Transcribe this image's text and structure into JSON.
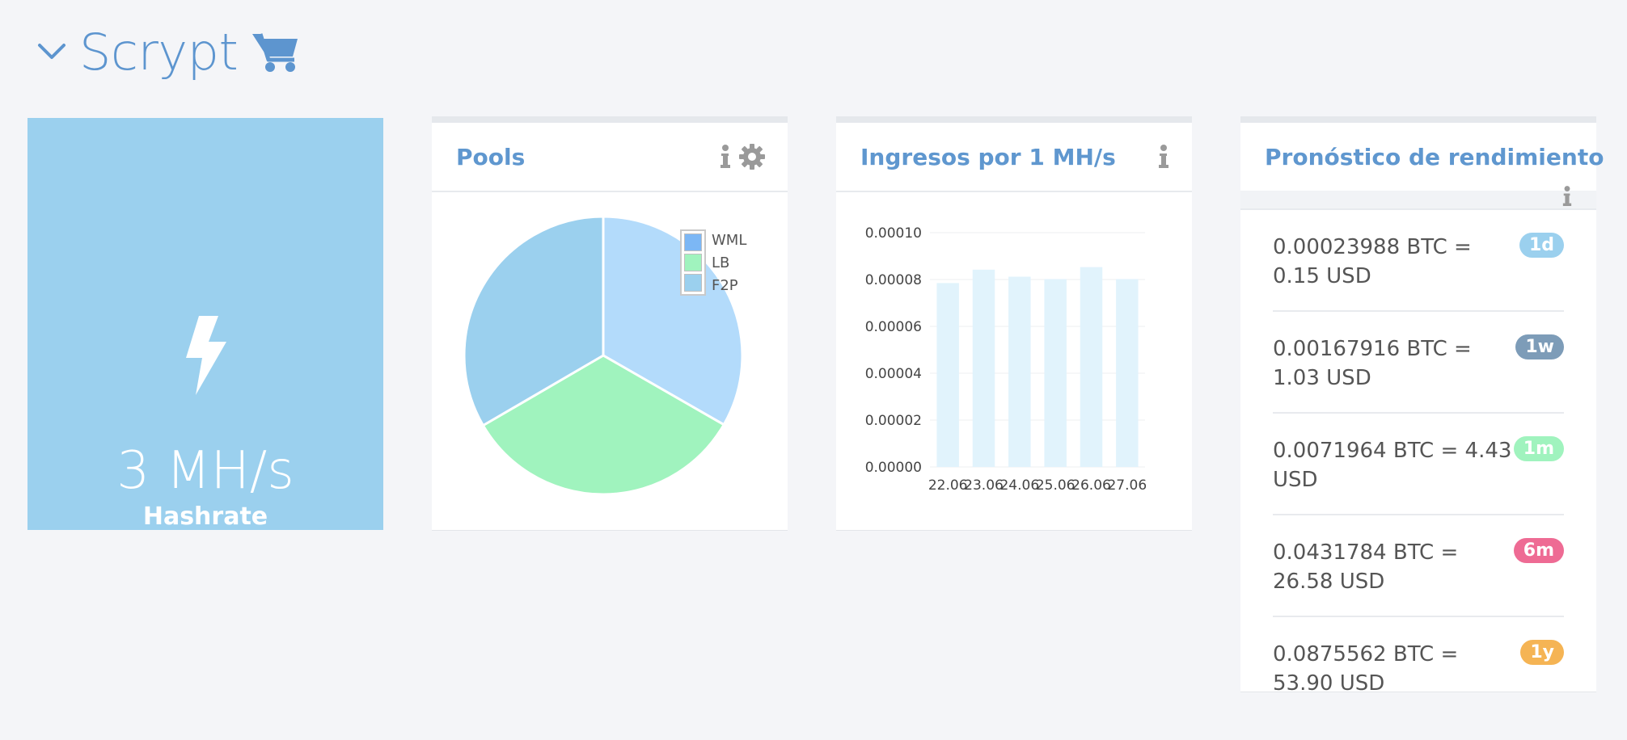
{
  "header": {
    "title": "Scrypt"
  },
  "icons": {
    "chevron": "chevron-down-icon",
    "cart": "shopping-cart-icon",
    "bolt": "lightning-bolt-icon",
    "info": "info-icon",
    "gear": "gear-icon"
  },
  "colors": {
    "accent": "#5d95cf",
    "hashrate_tile": "#9bd0ee",
    "title_text": "#5f97cf"
  },
  "hashrate": {
    "value": "3 MH/s",
    "label": "Hashrate"
  },
  "pools": {
    "title": "Pools",
    "chart_data": {
      "type": "pie",
      "labels": [
        "WML",
        "LB",
        "F2P"
      ],
      "values": [
        33.3,
        33.3,
        33.4
      ],
      "colors": [
        "#b3dbfb",
        "#a0f3be",
        "#9bd0ee"
      ],
      "legend_colors": [
        "#7cb7f5",
        "#a0f3be",
        "#9bd0ee"
      ],
      "legend_position": "top-right"
    }
  },
  "income": {
    "title": "Ingresos por 1 MH/s",
    "chart_data": {
      "type": "bar",
      "categories": [
        "22.06",
        "23.06",
        "24.06",
        "25.06",
        "26.06",
        "27.06"
      ],
      "values": [
        7.85e-05,
        8.42e-05,
        8.12e-05,
        8.02e-05,
        8.53e-05,
        8.02e-05
      ],
      "y_ticks": [
        "0.00000",
        "0.00002",
        "0.00004",
        "0.00006",
        "0.00008",
        "0.00010"
      ],
      "ylim": [
        0,
        0.0001
      ],
      "grid": true,
      "bar_color": "#e1f3fc"
    }
  },
  "forecast": {
    "title": "Pronóstico de rendimiento",
    "rows": [
      {
        "text": "0.00023988 BTC = 0.15 USD",
        "badge": "1d",
        "color": "#9bd0ee"
      },
      {
        "text": "0.00167916 BTC = 1.03 USD",
        "badge": "1w",
        "color": "#7d9cb8"
      },
      {
        "text": "0.0071964 BTC = 4.43 USD",
        "badge": "1m",
        "color": "#a0f3be"
      },
      {
        "text": "0.0431784 BTC = 26.58 USD",
        "badge": "6m",
        "color": "#ee6b94"
      },
      {
        "text": "0.0875562 BTC = 53.90 USD",
        "badge": "1y",
        "color": "#f5b454"
      }
    ]
  }
}
